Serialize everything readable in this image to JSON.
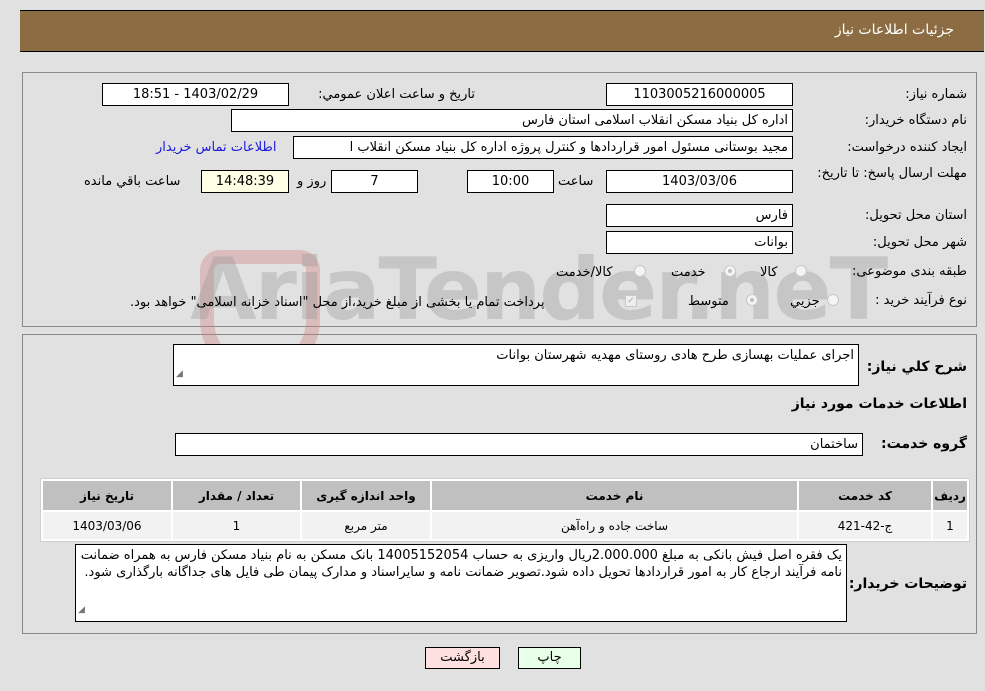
{
  "header": {
    "title": "جزئيات اطلاعات نياز"
  },
  "fields": {
    "need_number_label": "شماره نیاز:",
    "need_number": "1103005216000005",
    "announce_label": "تاريخ و ساعت اعلان عمومي:",
    "announce_value": "1403/02/29 - 18:51",
    "buyer_org_label": "نام دستگاه خریدار:",
    "buyer_org": "اداره کل بنیاد مسکن انقلاب اسلامی استان فارس",
    "creator_label": "ایجاد کننده درخواست:",
    "creator": "مجید بوستانی مسئول امور قراردادها و کنترل پروژه اداره کل بنیاد مسکن انقلاب ا",
    "buyer_contact_link": "اطلاعات تماس خریدار",
    "deadline_label": "مهلت ارسال پاسخ: تا تاریخ:",
    "deadline_date": "1403/03/06",
    "time_label": "ساعت",
    "deadline_time": "10:00",
    "days_value": "7",
    "days_label": "روز و",
    "remaining_time": "14:48:39",
    "remaining_label": "ساعت باقي مانده",
    "province_label": "استان محل تحویل:",
    "province": "فارس",
    "city_label": "شهر محل تحویل:",
    "city": "بوانات",
    "category_label": "طبقه بندی موضوعی:",
    "category_options": [
      "کالا",
      "خدمت",
      "کالا/خدمت"
    ],
    "category_selected": "خدمت",
    "process_label": "نوع فرآیند خرید :",
    "process_options": [
      "جزيي",
      "متوسط"
    ],
    "process_selected": "متوسط",
    "treasury_note": "پرداخت تمام یا بخشی از مبلغ خرید،از محل \"اسناد خزانه اسلامی\" خواهد بود."
  },
  "description": {
    "label": "شرح کلي نياز:",
    "value": "اجرای عملیات بهسازی طرح هادی روستای مهدیه شهرستان بوانات"
  },
  "services": {
    "section_title": "اطلاعات خدمات مورد نياز",
    "group_label": "گروه خدمت:",
    "group_value": "ساختمان",
    "table": {
      "headers": [
        "رديف",
        "کد خدمت",
        "نام خدمت",
        "واحد اندازه گيری",
        "تعداد / مقدار",
        "تاريخ نياز"
      ],
      "rows": [
        [
          "1",
          "ج-42-421",
          "ساخت جاده و راه‌آهن",
          "متر مربع",
          "1",
          "1403/03/06"
        ]
      ]
    }
  },
  "buyer_notes": {
    "label": "توضيحات خريدار:",
    "value": "یک فقره اصل فیش بانکی به مبلغ 2.000.000ریال واریزی به حساب 14005152054 بانک مسکن به نام بنیاد مسکن فارس به همراه ضمانت نامه فرآیند ارجاع کار به امور قراردادها تحویل داده شود.تصویر ضمانت نامه و سایراسناد و مدارک پیمان طی فایل های جداگانه بارگذاری شود."
  },
  "buttons": {
    "print": "چاپ",
    "back": "بازگشت"
  },
  "watermark": "AriaTender.neT"
}
